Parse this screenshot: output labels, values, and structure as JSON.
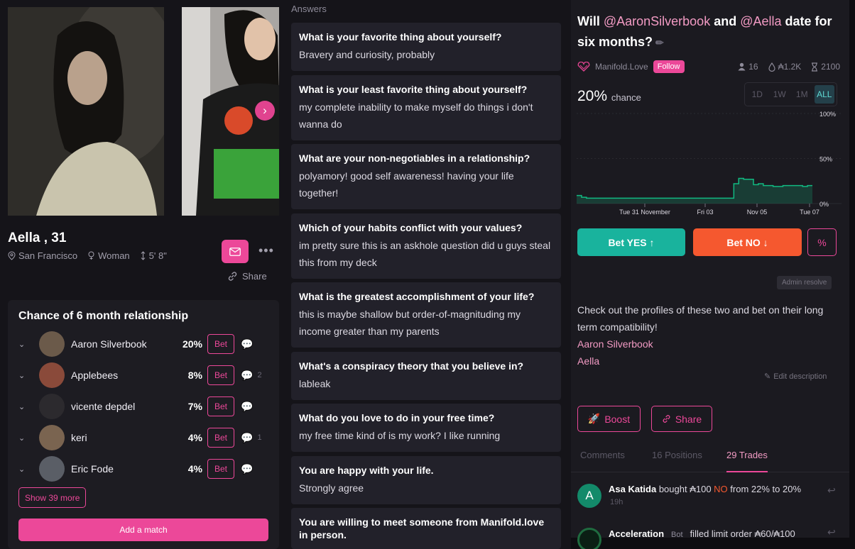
{
  "profile": {
    "name": "Aella",
    "age": "31",
    "location": "San Francisco",
    "gender": "Woman",
    "height": "5' 8\"",
    "share_label": "Share",
    "more_label": "•••",
    "next_photo_label": "›"
  },
  "relationship": {
    "title": "Chance of 6 month relationship",
    "bet_label": "Bet",
    "rows": [
      {
        "name": "Aaron Silverbook",
        "chance": "20%",
        "comments": "",
        "avatar_color": "#6b5a4a"
      },
      {
        "name": "Applebees",
        "chance": "8%",
        "comments": "2",
        "avatar_color": "#8a4a3a"
      },
      {
        "name": "vicente depdel",
        "chance": "7%",
        "comments": "",
        "avatar_color": "#2c2a2e"
      },
      {
        "name": "keri",
        "chance": "4%",
        "comments": "1",
        "avatar_color": "#7a6450"
      },
      {
        "name": "Eric Fode",
        "chance": "4%",
        "comments": "",
        "avatar_color": "#5a5e66"
      }
    ],
    "show_more": "Show 39 more",
    "add_match": "Add a match"
  },
  "answers": {
    "header": "Answers",
    "items": [
      {
        "q": "What is your favorite thing about yourself?",
        "a": "Bravery and curiosity, probably"
      },
      {
        "q": "What is your least favorite thing about yourself?",
        "a": "my complete inability to make myself do things i don't wanna do"
      },
      {
        "q": "What are your non-negotiables in a relationship?",
        "a": "polyamory! good self awareness! having your life together!"
      },
      {
        "q": "Which of your habits conflict with your values?",
        "a": "im pretty sure this is an askhole question did u guys steal this from my deck"
      },
      {
        "q": "What is the greatest accomplishment of your life?",
        "a": "this is maybe shallow but order-of-magnituding my income greater than my parents"
      },
      {
        "q": "What's a conspiracy theory that you believe in?",
        "a": "lableak"
      },
      {
        "q": "What do you love to do in your free time?",
        "a": "my free time kind of is my work? I like running"
      },
      {
        "q": "You are happy with your life.",
        "a": "Strongly agree"
      },
      {
        "q": "You are willing to meet someone from Manifold.love in person.",
        "a": ""
      }
    ]
  },
  "market": {
    "title_pre": "Will ",
    "mention1": "@AaronSilverbook",
    "title_mid": " and ",
    "mention2": "@Aella",
    "title_post": " date for six months?",
    "creator": "Manifold.Love",
    "follow_label": "Follow",
    "traders": "16",
    "volume": "₳1.2K",
    "liquidity": "2100",
    "chance_value": "20%",
    "chance_label": "chance",
    "ranges": [
      "1D",
      "1W",
      "1M",
      "ALL"
    ],
    "active_range": "ALL",
    "bet_yes": "Bet YES ↑",
    "bet_no": "Bet NO ↓",
    "pct_label": "%",
    "admin_resolve": "Admin resolve",
    "description_intro": "Check out the profiles of these two and bet on their long term compatibility!",
    "link1": "Aaron Silverbook",
    "link2": "Aella",
    "edit_description": "Edit description",
    "boost_label": "Boost",
    "share_label": "Share",
    "tabs": [
      "Comments",
      "16 Positions",
      "29 Trades"
    ],
    "active_tab": "29 Trades",
    "trade1": {
      "avatar_letter": "A",
      "user": "Asa Katida",
      "action": " bought ₳100 ",
      "outcome": "NO",
      "rest": " from 22% to 20%",
      "time": "19h"
    },
    "trade2": {
      "user": "Acceleration",
      "badge": "Bot",
      "action": "filled limit order ₳60/₳100"
    }
  },
  "chart_data": {
    "type": "area",
    "title": "",
    "x_labels": [
      "Tue 31 November",
      "Fri 03",
      "Nov 05",
      "Tue 07"
    ],
    "y_labels": [
      "100%",
      "50%",
      "0%"
    ],
    "ylim": [
      0,
      100
    ],
    "points_pct": [
      9,
      7,
      6,
      6,
      6,
      6,
      6,
      6,
      6,
      6,
      6,
      6,
      6,
      6,
      6,
      6,
      6,
      6,
      6,
      6,
      6,
      6,
      6,
      6,
      6,
      6,
      6,
      6,
      6,
      6,
      6,
      6,
      22,
      28,
      27,
      27,
      21,
      22,
      20,
      20,
      19,
      19,
      20,
      20,
      20,
      20,
      19,
      20,
      20
    ],
    "color": "#11b981"
  }
}
